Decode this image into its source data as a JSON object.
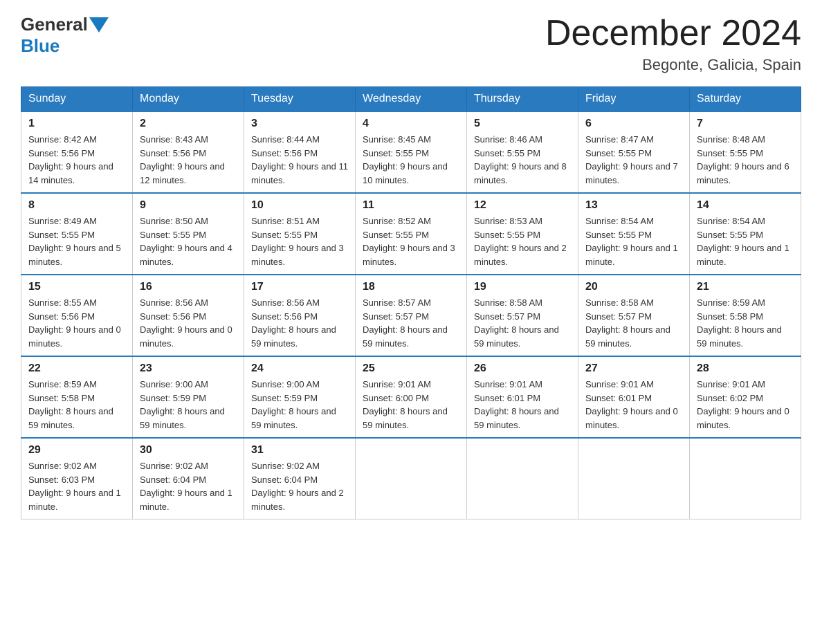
{
  "logo": {
    "general": "General",
    "blue": "Blue"
  },
  "title": "December 2024",
  "location": "Begonte, Galicia, Spain",
  "days_of_week": [
    "Sunday",
    "Monday",
    "Tuesday",
    "Wednesday",
    "Thursday",
    "Friday",
    "Saturday"
  ],
  "weeks": [
    [
      {
        "day": "1",
        "sunrise": "8:42 AM",
        "sunset": "5:56 PM",
        "daylight": "9 hours and 14 minutes."
      },
      {
        "day": "2",
        "sunrise": "8:43 AM",
        "sunset": "5:56 PM",
        "daylight": "9 hours and 12 minutes."
      },
      {
        "day": "3",
        "sunrise": "8:44 AM",
        "sunset": "5:56 PM",
        "daylight": "9 hours and 11 minutes."
      },
      {
        "day": "4",
        "sunrise": "8:45 AM",
        "sunset": "5:55 PM",
        "daylight": "9 hours and 10 minutes."
      },
      {
        "day": "5",
        "sunrise": "8:46 AM",
        "sunset": "5:55 PM",
        "daylight": "9 hours and 8 minutes."
      },
      {
        "day": "6",
        "sunrise": "8:47 AM",
        "sunset": "5:55 PM",
        "daylight": "9 hours and 7 minutes."
      },
      {
        "day": "7",
        "sunrise": "8:48 AM",
        "sunset": "5:55 PM",
        "daylight": "9 hours and 6 minutes."
      }
    ],
    [
      {
        "day": "8",
        "sunrise": "8:49 AM",
        "sunset": "5:55 PM",
        "daylight": "9 hours and 5 minutes."
      },
      {
        "day": "9",
        "sunrise": "8:50 AM",
        "sunset": "5:55 PM",
        "daylight": "9 hours and 4 minutes."
      },
      {
        "day": "10",
        "sunrise": "8:51 AM",
        "sunset": "5:55 PM",
        "daylight": "9 hours and 3 minutes."
      },
      {
        "day": "11",
        "sunrise": "8:52 AM",
        "sunset": "5:55 PM",
        "daylight": "9 hours and 3 minutes."
      },
      {
        "day": "12",
        "sunrise": "8:53 AM",
        "sunset": "5:55 PM",
        "daylight": "9 hours and 2 minutes."
      },
      {
        "day": "13",
        "sunrise": "8:54 AM",
        "sunset": "5:55 PM",
        "daylight": "9 hours and 1 minute."
      },
      {
        "day": "14",
        "sunrise": "8:54 AM",
        "sunset": "5:55 PM",
        "daylight": "9 hours and 1 minute."
      }
    ],
    [
      {
        "day": "15",
        "sunrise": "8:55 AM",
        "sunset": "5:56 PM",
        "daylight": "9 hours and 0 minutes."
      },
      {
        "day": "16",
        "sunrise": "8:56 AM",
        "sunset": "5:56 PM",
        "daylight": "9 hours and 0 minutes."
      },
      {
        "day": "17",
        "sunrise": "8:56 AM",
        "sunset": "5:56 PM",
        "daylight": "8 hours and 59 minutes."
      },
      {
        "day": "18",
        "sunrise": "8:57 AM",
        "sunset": "5:57 PM",
        "daylight": "8 hours and 59 minutes."
      },
      {
        "day": "19",
        "sunrise": "8:58 AM",
        "sunset": "5:57 PM",
        "daylight": "8 hours and 59 minutes."
      },
      {
        "day": "20",
        "sunrise": "8:58 AM",
        "sunset": "5:57 PM",
        "daylight": "8 hours and 59 minutes."
      },
      {
        "day": "21",
        "sunrise": "8:59 AM",
        "sunset": "5:58 PM",
        "daylight": "8 hours and 59 minutes."
      }
    ],
    [
      {
        "day": "22",
        "sunrise": "8:59 AM",
        "sunset": "5:58 PM",
        "daylight": "8 hours and 59 minutes."
      },
      {
        "day": "23",
        "sunrise": "9:00 AM",
        "sunset": "5:59 PM",
        "daylight": "8 hours and 59 minutes."
      },
      {
        "day": "24",
        "sunrise": "9:00 AM",
        "sunset": "5:59 PM",
        "daylight": "8 hours and 59 minutes."
      },
      {
        "day": "25",
        "sunrise": "9:01 AM",
        "sunset": "6:00 PM",
        "daylight": "8 hours and 59 minutes."
      },
      {
        "day": "26",
        "sunrise": "9:01 AM",
        "sunset": "6:01 PM",
        "daylight": "8 hours and 59 minutes."
      },
      {
        "day": "27",
        "sunrise": "9:01 AM",
        "sunset": "6:01 PM",
        "daylight": "9 hours and 0 minutes."
      },
      {
        "day": "28",
        "sunrise": "9:01 AM",
        "sunset": "6:02 PM",
        "daylight": "9 hours and 0 minutes."
      }
    ],
    [
      {
        "day": "29",
        "sunrise": "9:02 AM",
        "sunset": "6:03 PM",
        "daylight": "9 hours and 1 minute."
      },
      {
        "day": "30",
        "sunrise": "9:02 AM",
        "sunset": "6:04 PM",
        "daylight": "9 hours and 1 minute."
      },
      {
        "day": "31",
        "sunrise": "9:02 AM",
        "sunset": "6:04 PM",
        "daylight": "9 hours and 2 minutes."
      },
      null,
      null,
      null,
      null
    ]
  ],
  "labels": {
    "sunrise": "Sunrise:",
    "sunset": "Sunset:",
    "daylight": "Daylight:"
  },
  "colors": {
    "header_bg": "#2a7abf",
    "border_top": "#2a7abf"
  }
}
